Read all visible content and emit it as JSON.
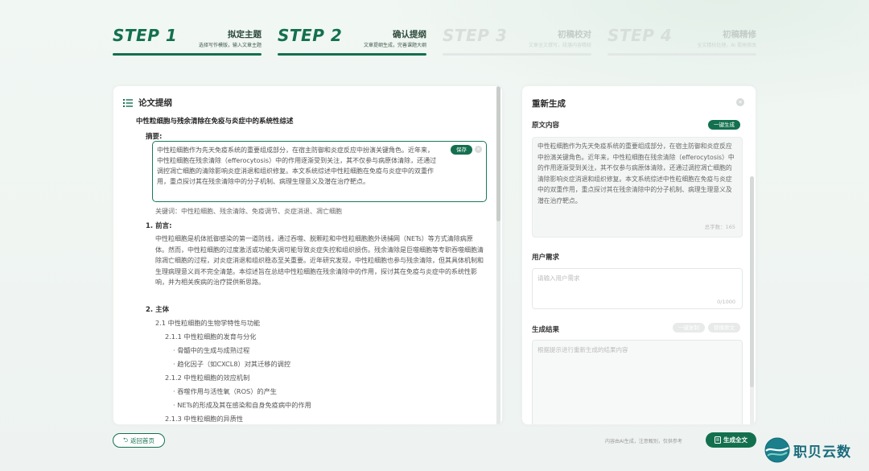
{
  "steps": [
    {
      "num": "STEP 1",
      "title": "拟定主题",
      "sub": "选择写作模版，输入文章主题",
      "active": true
    },
    {
      "num": "STEP 2",
      "title": "确认提纲",
      "sub": "文章提纲生成，完善课题大纲",
      "active": true
    },
    {
      "num": "STEP 3",
      "title": "初稿校对",
      "sub": "文章全文撰写，段落内容精校",
      "active": false
    },
    {
      "num": "STEP 4",
      "title": "初稿精修",
      "sub": "全文精校处理，AI 提高修改",
      "active": false
    }
  ],
  "outline": {
    "heading": "论文提纲",
    "doc_title": "中性粒细胞与残余清除在免疫与炎症中的系统性综述",
    "abstract_label": "摘要:",
    "abstract_text": "中性粒细胞作为先天免疫系统的重要组成部分，在宿主防御和炎症反应中扮演关键角色。近年来，中性粒细胞在残余清除（efferocytosis）中的作用逐渐受到关注，其不仅参与病原体清除，还通过调控凋亡细胞的清除影响炎症消退和组织修复。本文系统综述中性粒细胞在免疫与炎症中的双重作用，重点探讨其在残余清除中的分子机制、病理生理意义及潜在治疗靶点。",
    "save_label": "保存",
    "keywords": "关键词：中性粒细胞、残余清除、免疫调节、炎症消退、凋亡细胞",
    "sec1": "1. 前言:",
    "intro_text": "中性粒细胞是机体抵御感染的第一道防线，通过吞噬、脱颗粒和中性粒细胞胞外诱捕网（NETs）等方式清除病原体。然而，中性粒细胞的过度激活或功能失调可能导致炎症失控和组织损伤。残余清除是巨噬细胞等专职吞噬细胞清除凋亡细胞的过程，对炎症消退和组织稳态至关重要。近年研究发现，中性粒细胞也参与残余清除，但其具体机制和生理病理意义尚不完全清楚。本综述旨在总结中性粒细胞在残余清除中的作用，探讨其在免疫与炎症中的系统性影响，并为相关疾病的治疗提供新思路。",
    "sec2": "2. 主体",
    "s21": "2.1 中性粒细胞的生物学特性与功能",
    "s211": "2.1.1 中性粒细胞的发育与分化",
    "b1": "· 骨髓中的生成与成熟过程",
    "b2": "· 趋化因子（如CXCL8）对其迁移的调控",
    "s212": "2.1.2 中性粒细胞的效应机制",
    "b3": "· 吞噬作用与活性氧（ROS）的产生",
    "b4": "· NETs的形成及其在感染和自身免疫病中的作用",
    "s213": "2.1.3 中性粒细胞的异质性"
  },
  "regen": {
    "title": "重新生成",
    "orig_label": "原文内容",
    "one_click": "一键生成",
    "orig_text": "中性粒细胞作为先天免疫系统的重要组成部分，在宿主防御和炎症反应中扮演关键角色。近年来，中性粒细胞在残余清除（efferocytosis）中的作用逐渐受到关注，其不仅参与病原体清除，还通过调控凋亡细胞的清除影响炎症消退和组织修复。本文系统综述中性粒细胞在免疫与炎症中的双重作用，重点探讨其在残余清除中的分子机制、病理生理意义及潜在治疗靶点。",
    "char_count": "总字数：165",
    "req_label": "用户需求",
    "req_placeholder": "请输入用户需求",
    "req_count": "0/1000",
    "result_label": "生成结果",
    "copy_label": "一键复制",
    "replace_label": "替换原文",
    "result_placeholder": "根据提示进行重新生成的结果内容"
  },
  "footer": {
    "home_label": "返回首页",
    "disclaimer": "内容由AI生成，注意甄别，仅供参考",
    "gen_label": "生成全文",
    "logo_text": "职贝云数"
  },
  "colors": {
    "primary": "#13704f",
    "inactive": "#d8dfdb"
  }
}
